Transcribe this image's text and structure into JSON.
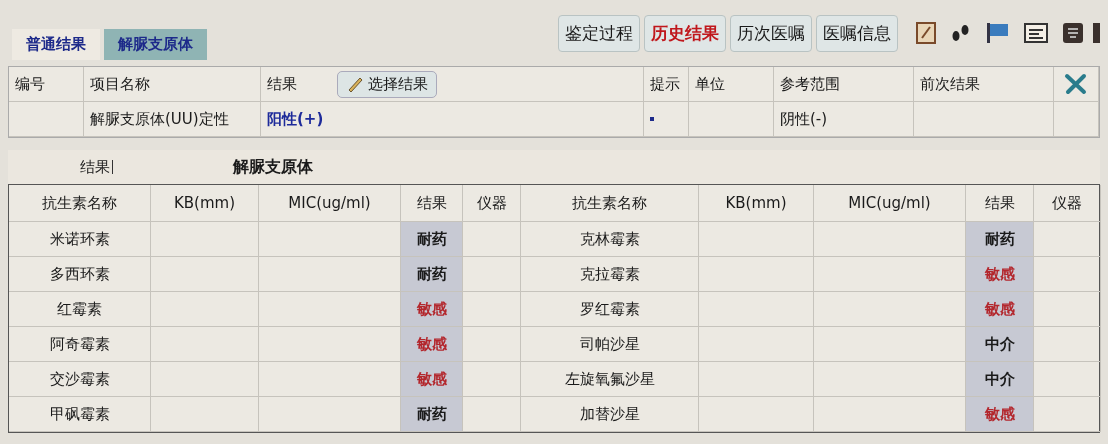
{
  "tabs": [
    {
      "label": "普通结果",
      "selected": false
    },
    {
      "label": "解脲支原体",
      "selected": true
    }
  ],
  "buttons": [
    {
      "label": "鉴定过程",
      "highlighted": false
    },
    {
      "label": "历史结果",
      "highlighted": true
    },
    {
      "label": "历次医嘱",
      "highlighted": false
    },
    {
      "label": "医嘱信息",
      "highlighted": false
    }
  ],
  "items_table": {
    "columns": [
      "编号",
      "项目名称",
      "结果",
      "提示",
      "单位",
      "参考范围",
      "前次结果"
    ],
    "select_button": "选择结果",
    "rows": [
      {
        "name": "解脲支原体(UU)定性",
        "result": "阳性(+)",
        "flagged": true,
        "reference": "阴性(-)"
      }
    ]
  },
  "culture": {
    "label": "结果",
    "organism": "解脲支原体"
  },
  "antibiotic_table": {
    "columns": [
      "抗生素名称",
      "KB(mm)",
      "MIC(ug/ml)",
      "结果",
      "仪器",
      "抗生素名称",
      "KB(mm)",
      "MIC(ug/ml)",
      "结果",
      "仪器"
    ],
    "rows": [
      {
        "left": {
          "name": "米诺环素",
          "result": "耐药",
          "kind": "resistant"
        },
        "right": {
          "name": "克林霉素",
          "result": "耐药",
          "kind": "resistant"
        }
      },
      {
        "left": {
          "name": "多西环素",
          "result": "耐药",
          "kind": "resistant"
        },
        "right": {
          "name": "克拉霉素",
          "result": "敏感",
          "kind": "sensitive"
        }
      },
      {
        "left": {
          "name": "红霉素",
          "result": "敏感",
          "kind": "sensitive"
        },
        "right": {
          "name": "罗红霉素",
          "result": "敏感",
          "kind": "sensitive"
        }
      },
      {
        "left": {
          "name": "阿奇霉素",
          "result": "敏感",
          "kind": "sensitive"
        },
        "right": {
          "name": "司帕沙星",
          "result": "中介",
          "kind": "intermediate"
        }
      },
      {
        "left": {
          "name": "交沙霉素",
          "result": "敏感",
          "kind": "sensitive"
        },
        "right": {
          "name": "左旋氧氟沙星",
          "result": "中介",
          "kind": "intermediate"
        }
      },
      {
        "left": {
          "name": "甲砜霉素",
          "result": "耐药",
          "kind": "resistant"
        },
        "right": {
          "name": "加替沙星",
          "result": "敏感",
          "kind": "sensitive"
        }
      }
    ]
  }
}
